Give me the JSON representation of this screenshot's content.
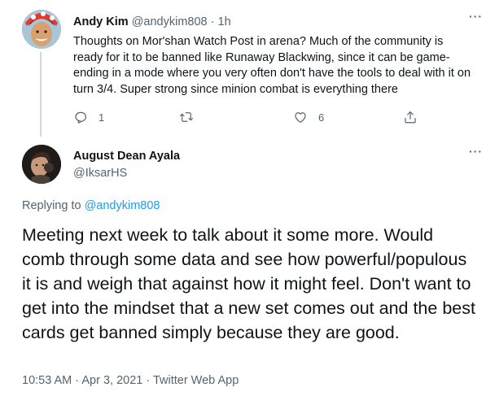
{
  "parent_tweet": {
    "author_name": "Andy Kim",
    "author_handle": "@andykim808",
    "separator": "·",
    "time": "1h",
    "text": "Thoughts on Mor'shan Watch Post in arena?  Much of the community is ready for it to be banned like Runaway Blackwing, since it can be game-ending in a mode where you very often don't have the tools to deal with it on turn 3/4.  Super strong since minion combat is everything there",
    "more_label": "···",
    "actions": {
      "reply_icon": "reply-icon",
      "reply_count": "1",
      "retweet_icon": "retweet-icon",
      "like_icon": "heart-icon",
      "like_count": "6",
      "share_icon": "share-icon"
    }
  },
  "main_tweet": {
    "author_name": "August Dean Ayala",
    "author_handle": "@IksarHS",
    "more_label": "···",
    "replying_prefix": "Replying to ",
    "replying_to": "@andykim808",
    "text": "Meeting next week to talk about it some more. Would comb through some data and see how powerful/populous it is and weigh that against how it might feel. Don't want to get into the mindset that a new set comes out and the best cards get banned simply because they are good.",
    "meta": "10:53 AM · Apr 3, 2021 · Twitter Web App"
  },
  "colors": {
    "accent": "#1d9bf0",
    "secondary_text": "#536471",
    "primary_text": "#0f1419",
    "thread_line": "#cfd9de"
  }
}
